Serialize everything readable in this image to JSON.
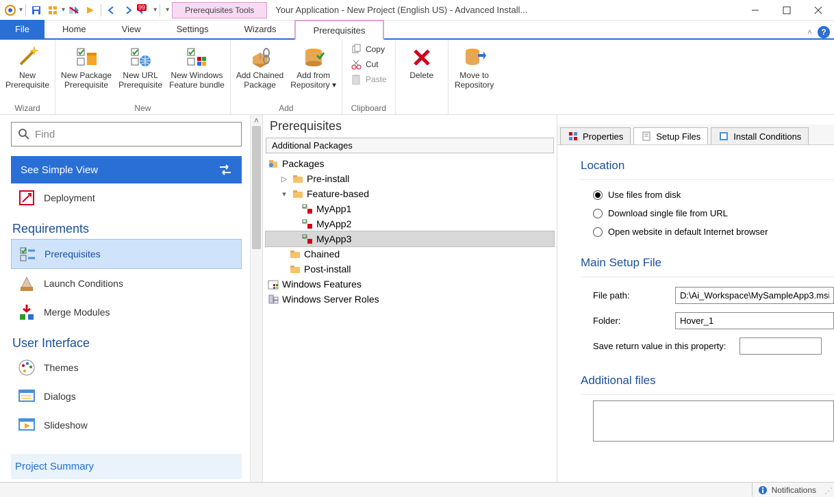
{
  "titlebar": {
    "context_tab": "Prerequisites Tools",
    "window_title": "Your Application - New Project (English US) - Advanced Install..."
  },
  "tabs": {
    "file": "File",
    "home": "Home",
    "view": "View",
    "settings": "Settings",
    "wizards": "Wizards",
    "prerequisites": "Prerequisites"
  },
  "ribbon": {
    "wizard": {
      "new_prereq": "New\nPrerequisite",
      "group": "Wizard"
    },
    "new": {
      "new_pkg_prereq": "New Package\nPrerequisite",
      "new_url_prereq": "New URL\nPrerequisite",
      "new_win_feat": "New Windows\nFeature bundle",
      "group": "New"
    },
    "add": {
      "chained": "Add Chained\nPackage",
      "repo": "Add from\nRepository",
      "group": "Add"
    },
    "clipboard": {
      "copy": "Copy",
      "cut": "Cut",
      "paste": "Paste",
      "group": "Clipboard"
    },
    "delete": "Delete",
    "move_repo": "Move to\nRepository"
  },
  "left": {
    "find_placeholder": "Find",
    "simple_view": "See Simple View",
    "deployment": "Deployment",
    "requirements_h": "Requirements",
    "prerequisites": "Prerequisites",
    "launch_conditions": "Launch Conditions",
    "merge_modules": "Merge Modules",
    "ui_h": "User Interface",
    "themes": "Themes",
    "dialogs": "Dialogs",
    "slideshow": "Slideshow",
    "project_summary": "Project Summary"
  },
  "tree": {
    "title": "Prerequisites",
    "subtitle": "Additional Packages",
    "packages": "Packages",
    "preinstall": "Pre-install",
    "feature_based": "Feature-based",
    "myapp1": "MyApp1",
    "myapp2": "MyApp2",
    "myapp3": "MyApp3",
    "chained": "Chained",
    "postinstall": "Post-install",
    "win_features": "Windows Features",
    "win_server_roles": "Windows Server Roles"
  },
  "props": {
    "tab_properties": "Properties",
    "tab_setup_files": "Setup Files",
    "tab_install_cond": "Install Conditions",
    "location_h": "Location",
    "loc_disk": "Use files from disk",
    "loc_url": "Download single file from URL",
    "loc_web": "Open website in default Internet browser",
    "main_setup_h": "Main Setup File",
    "file_path_l": "File path:",
    "file_path_v": "D:\\Ai_Workspace\\MySampleApp3.msi",
    "folder_l": "Folder:",
    "folder_v": "Hover_1",
    "save_return_l": "Save return value in this property:",
    "additional_h": "Additional files"
  },
  "status": {
    "notifications": "Notifications"
  }
}
